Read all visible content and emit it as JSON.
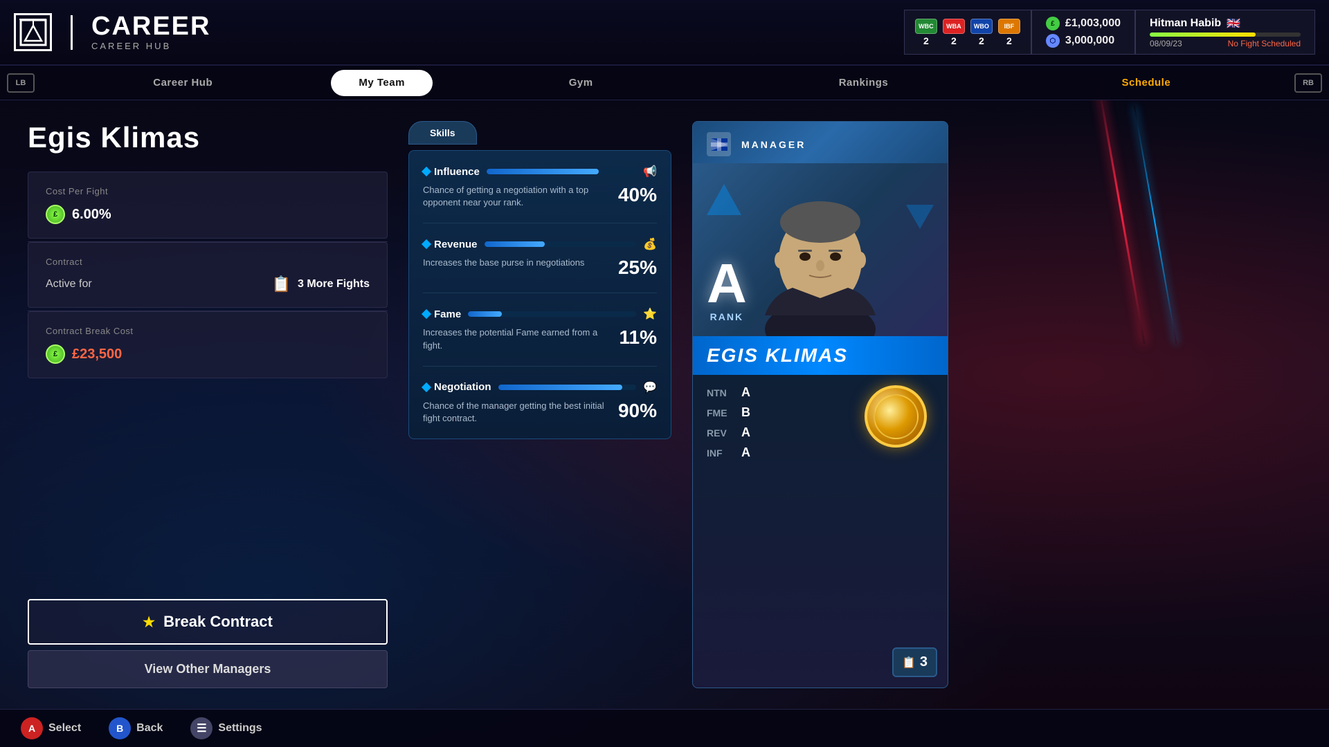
{
  "app": {
    "logo_main": "CAREER",
    "logo_sub": "CAREER HUB"
  },
  "hud": {
    "belts": [
      {
        "label": "WBC",
        "color": "#228833",
        "count": "2"
      },
      {
        "label": "WBA",
        "color": "#dd2222",
        "count": "2"
      },
      {
        "label": "WBO",
        "color": "#1144aa",
        "count": "2"
      },
      {
        "label": "IBF",
        "color": "#dd7700",
        "count": "2"
      }
    ],
    "money1": "£1,003,000",
    "money2": "3,000,000",
    "player_name": "Hitman Habib",
    "player_flag": "🇬🇧",
    "xp_percent": 70,
    "date": "08/09/23",
    "no_fight": "No Fight Scheduled"
  },
  "nav": {
    "lb": "LB",
    "rb": "RB",
    "tabs": [
      {
        "label": "Career Hub",
        "active": false
      },
      {
        "label": "My Team",
        "active": true
      },
      {
        "label": "Gym",
        "active": false
      },
      {
        "label": "Rankings",
        "active": false
      },
      {
        "label": "Schedule",
        "active": false,
        "highlight": true
      }
    ]
  },
  "left": {
    "manager_name": "Egis Klimas",
    "cost_per_fight_label": "Cost Per Fight",
    "cost_value": "6.00%",
    "contract_label": "Contract",
    "active_for_label": "Active for",
    "fights_remaining": "3 More Fights",
    "break_cost_label": "Contract Break Cost",
    "break_cost_value": "£23,500",
    "break_btn": "Break Contract",
    "view_btn": "View Other Managers"
  },
  "skills": {
    "tab_label": "Skills",
    "items": [
      {
        "name": "Influence",
        "icon": "📢",
        "description": "Chance of getting a negotiation with a top opponent near your rank.",
        "value": "40%",
        "fill": 75
      },
      {
        "name": "Revenue",
        "icon": "💰",
        "description": "Increases the base purse in negotiations",
        "value": "25%",
        "fill": 40
      },
      {
        "name": "Fame",
        "icon": "⭐",
        "description": "Increases the potential Fame earned from a fight.",
        "value": "11%",
        "fill": 20
      },
      {
        "name": "Negotiation",
        "icon": "💬",
        "description": "Chance of the manager getting the best initial fight contract.",
        "value": "90%",
        "fill": 90
      }
    ]
  },
  "manager_card": {
    "label": "MANAGER",
    "rank_letter": "A",
    "rank_label": "RANK",
    "name": "EGIS KLIMAS",
    "stats": [
      {
        "key": "NTN",
        "val": "A"
      },
      {
        "key": "FME",
        "val": "B"
      },
      {
        "key": "REV",
        "val": "A"
      },
      {
        "key": "INF",
        "val": "A"
      }
    ],
    "contract_num": "3"
  },
  "bottom": {
    "select_label": "Select",
    "back_label": "Back",
    "settings_label": "Settings"
  }
}
